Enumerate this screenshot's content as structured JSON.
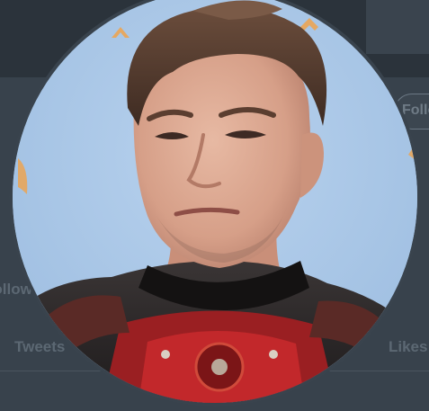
{
  "profile": {
    "follow_button_label": "Follow",
    "follow_text": "Follow",
    "tabs": {
      "tweets": "Tweets",
      "likes": "Likes"
    }
  },
  "colors": {
    "background": "#38424c",
    "header": "#2b333b",
    "photo_backdrop": "#a9c6e6",
    "accent_logo": "#f0a24a"
  },
  "icons": {
    "avatar": "profile-photo"
  }
}
